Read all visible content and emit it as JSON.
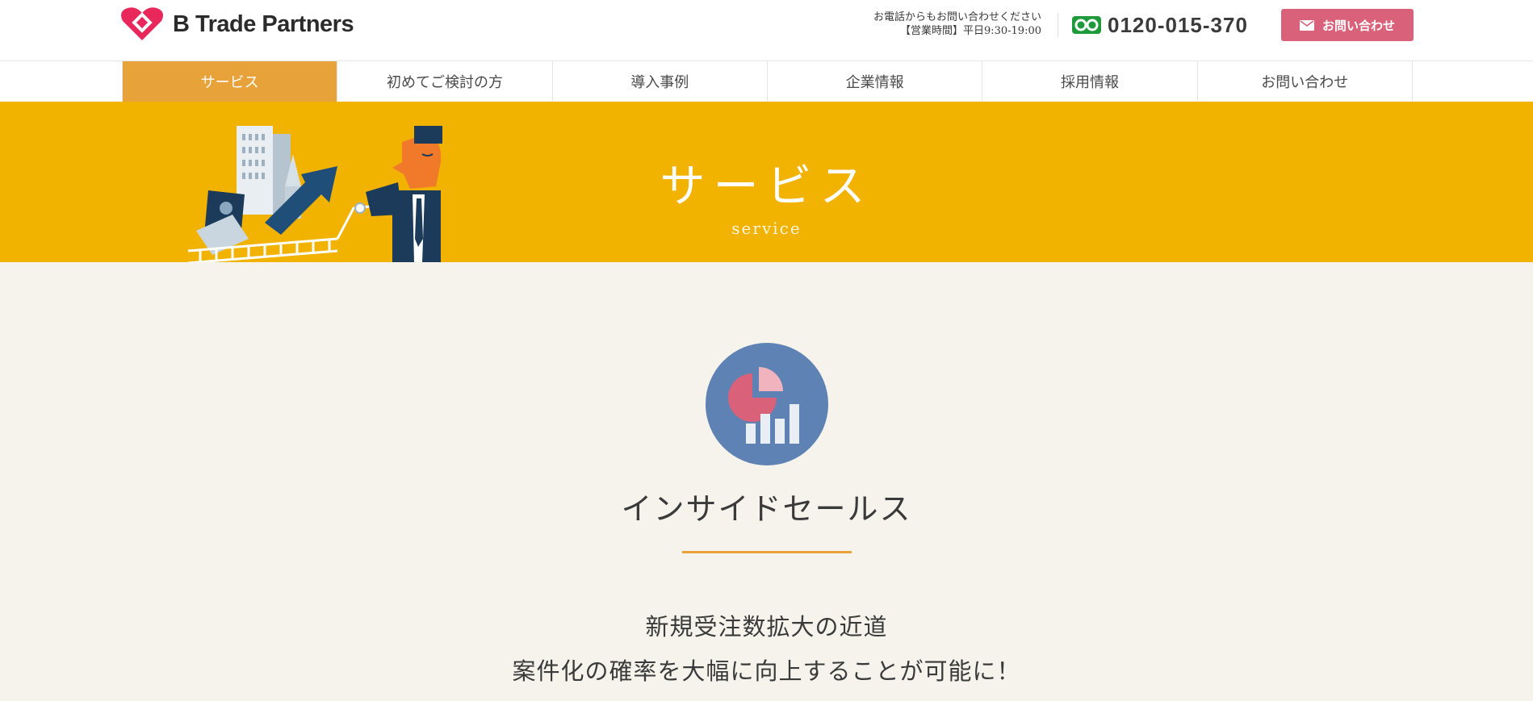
{
  "header": {
    "logo_text": "B Trade Partners",
    "contact_note": "お電話からもお問い合わせください",
    "hours": "【営業時間】平日9:30-19:00",
    "phone": "0120-015-370",
    "contact_button_label": "お問い合わせ",
    "brand_color": "#e8285a"
  },
  "nav": {
    "items": [
      {
        "label": "サービス",
        "active": true
      },
      {
        "label": "初めてご検討の方",
        "active": false
      },
      {
        "label": "導入事例",
        "active": false
      },
      {
        "label": "企業情報",
        "active": false
      },
      {
        "label": "採用情報",
        "active": false
      },
      {
        "label": "お問い合わせ",
        "active": false
      }
    ],
    "active_color": "#e7a23a"
  },
  "banner": {
    "title": "サービス",
    "subtitle": "service",
    "background_color": "#f2b200"
  },
  "service": {
    "icon": "pie-bar-chart-icon",
    "title": "インサイドセールス",
    "lead_line1": "新規受注数拡大の近道",
    "lead_line2": "案件化の確率を大幅に向上することが可能に！"
  }
}
